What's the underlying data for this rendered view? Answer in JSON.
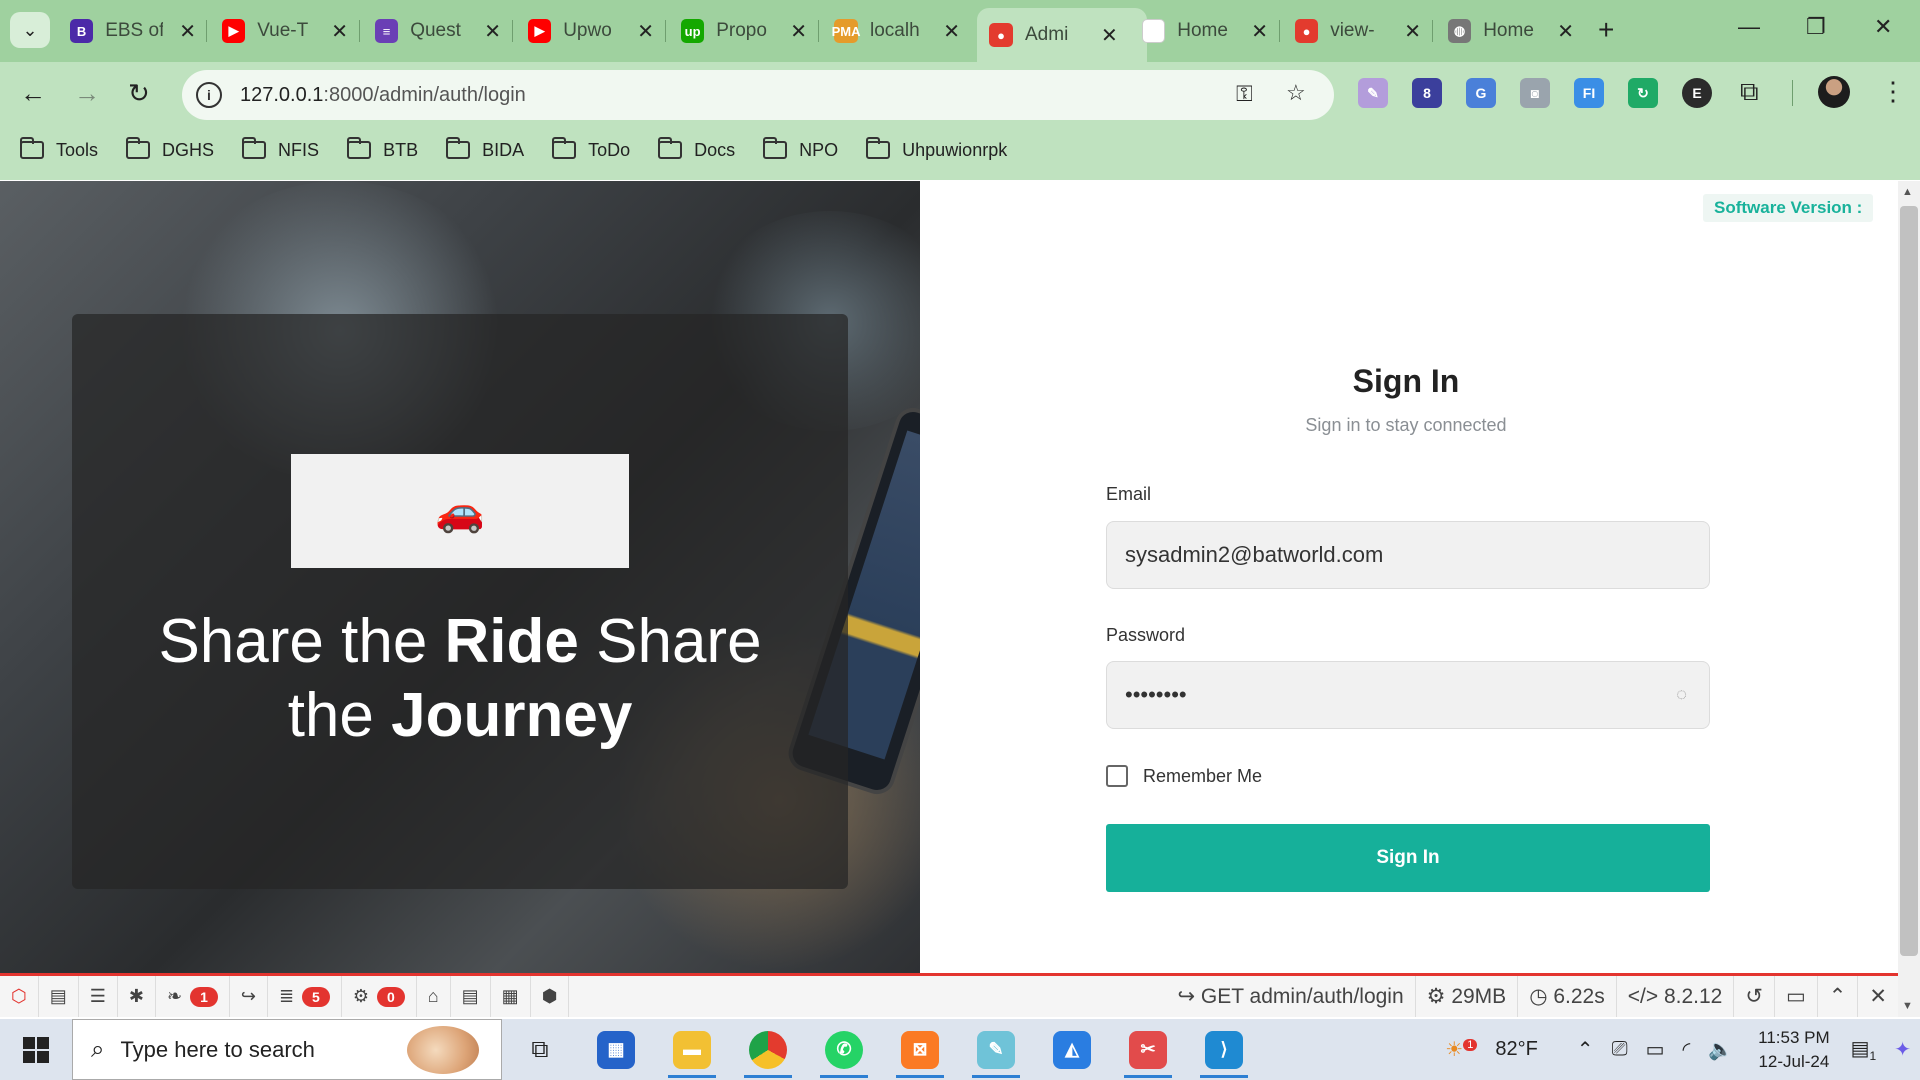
{
  "browser": {
    "tabs": [
      {
        "title": "EBS of",
        "icon": "bootstrap-icon",
        "color": "#4b2aa8",
        "glyph": "B"
      },
      {
        "title": "Vue-T",
        "icon": "youtube-icon",
        "color": "#ff0000",
        "glyph": "▶"
      },
      {
        "title": "Quest",
        "icon": "forms-icon",
        "color": "#6a3fb5",
        "glyph": "≡"
      },
      {
        "title": "Upwo",
        "icon": "youtube-icon",
        "color": "#ff0000",
        "glyph": "▶"
      },
      {
        "title": "Propo",
        "icon": "upwork-icon",
        "color": "#14a800",
        "glyph": "up"
      },
      {
        "title": "localh",
        "icon": "phpmyadmin-icon",
        "color": "#e59b2b",
        "glyph": "PMA"
      },
      {
        "title": "Admi",
        "icon": "app-favicon-icon",
        "color": "#e33b2e",
        "glyph": "●",
        "active": true
      },
      {
        "title": "Home",
        "icon": "blank-page-icon",
        "color": "#ffffff",
        "glyph": ""
      },
      {
        "title": "view-",
        "icon": "app-favicon-icon",
        "color": "#e33b2e",
        "glyph": "●"
      },
      {
        "title": "Home",
        "icon": "globe-icon",
        "color": "#777777",
        "glyph": "◍"
      }
    ],
    "url_host": "127.0.0.1",
    "url_rest": ":8000/admin/auth/login",
    "bookmarks": [
      "Tools",
      "DGHS",
      "NFIS",
      "BTB",
      "BIDA",
      "ToDo",
      "Docs",
      "NPO",
      "Uhpuwionrpk"
    ],
    "extensions": [
      {
        "name": "pen-extension-icon",
        "color": "#b39ddb",
        "glyph": "✎"
      },
      {
        "name": "hat-extension-icon",
        "color": "#3b3f9c",
        "glyph": "8"
      },
      {
        "name": "translate-extension-icon",
        "color": "#4a80d9",
        "glyph": "G"
      },
      {
        "name": "profile-extension-icon",
        "color": "#9aa4ad",
        "glyph": "◙"
      },
      {
        "name": "fi-extension-icon",
        "color": "#3a8ee6",
        "glyph": "FI"
      },
      {
        "name": "sync-extension-icon",
        "color": "#1faa66",
        "glyph": "↻"
      },
      {
        "name": "e-extension-icon",
        "color": "#2b2b2b",
        "glyph": "E"
      }
    ]
  },
  "hero": {
    "title_part1": "Share the ",
    "title_bold1": "Ride",
    "title_part2": " Share the ",
    "title_bold2": "Journey"
  },
  "login": {
    "version_label": "Software Version :",
    "title": "Sign In",
    "subtitle": "Sign in to stay connected",
    "email_label": "Email",
    "email_value": "sysadmin2@batworld.com",
    "password_label": "Password",
    "password_value": "••••••••",
    "remember_label": "Remember Me",
    "submit_label": "Sign In"
  },
  "debugbar": {
    "badge_logs": "1",
    "badge_queries": "5",
    "badge_models": "0",
    "route": "GET admin/auth/login",
    "memory": "29MB",
    "time": "6.22s",
    "php": "8.2.12"
  },
  "taskbar": {
    "search_placeholder": "Type here to search",
    "weather_badge": "1",
    "temperature": "82°F",
    "time": "11:53 PM",
    "date": "12-Jul-24",
    "notif_count": "1"
  }
}
